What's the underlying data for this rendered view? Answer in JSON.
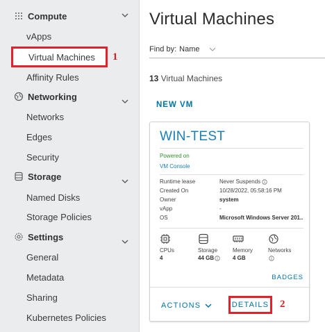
{
  "sidebar": {
    "sections": [
      {
        "title": "Compute",
        "icon": "grid-dots-icon",
        "items": [
          "vApps",
          "Virtual Machines",
          "Affinity Rules"
        ]
      },
      {
        "title": "Networking",
        "icon": "network-icon",
        "items": [
          "Networks",
          "Edges",
          "Security"
        ]
      },
      {
        "title": "Storage",
        "icon": "database-icon",
        "items": [
          "Named Disks",
          "Storage Policies"
        ]
      },
      {
        "title": "Settings",
        "icon": "gear-icon",
        "items": [
          "General",
          "Metadata",
          "Sharing",
          "Kubernetes Policies"
        ]
      }
    ]
  },
  "annotations": {
    "one": "1",
    "two": "2"
  },
  "main": {
    "title": "Virtual Machines",
    "find_by_label": "Find by:",
    "find_by_value": "Name",
    "count_number": "13",
    "count_text": " Virtual Machines",
    "new_vm": "NEW VM"
  },
  "card": {
    "name": "WIN-TEST",
    "status": "Powered on",
    "console": "VM Console",
    "details": [
      {
        "key": "Runtime lease",
        "value": "Never Suspends"
      },
      {
        "key": "Created On",
        "value": "10/28/2022, 05:58:16 PM"
      },
      {
        "key": "Owner",
        "value": "system"
      },
      {
        "key": "vApp",
        "value": "-"
      },
      {
        "key": "OS",
        "value": "Microsoft Windows Server 201.."
      }
    ],
    "resources": [
      {
        "label": "CPUs",
        "value": "4",
        "icon": "cpu-icon"
      },
      {
        "label": "Storage",
        "value": "44 GB",
        "icon": "storage-icon"
      },
      {
        "label": "Memory",
        "value": "4 GB",
        "icon": "memory-icon"
      },
      {
        "label": "Networks",
        "value": "",
        "icon": "network-icon"
      }
    ],
    "badges": "BADGES",
    "actions": "ACTIONS",
    "details_button": "DETAILS"
  },
  "colors": {
    "accent": "#0072a3",
    "highlight": "#e3202b",
    "sidebar_bg": "#eaecee",
    "powered_on": "#2d8f2d"
  }
}
